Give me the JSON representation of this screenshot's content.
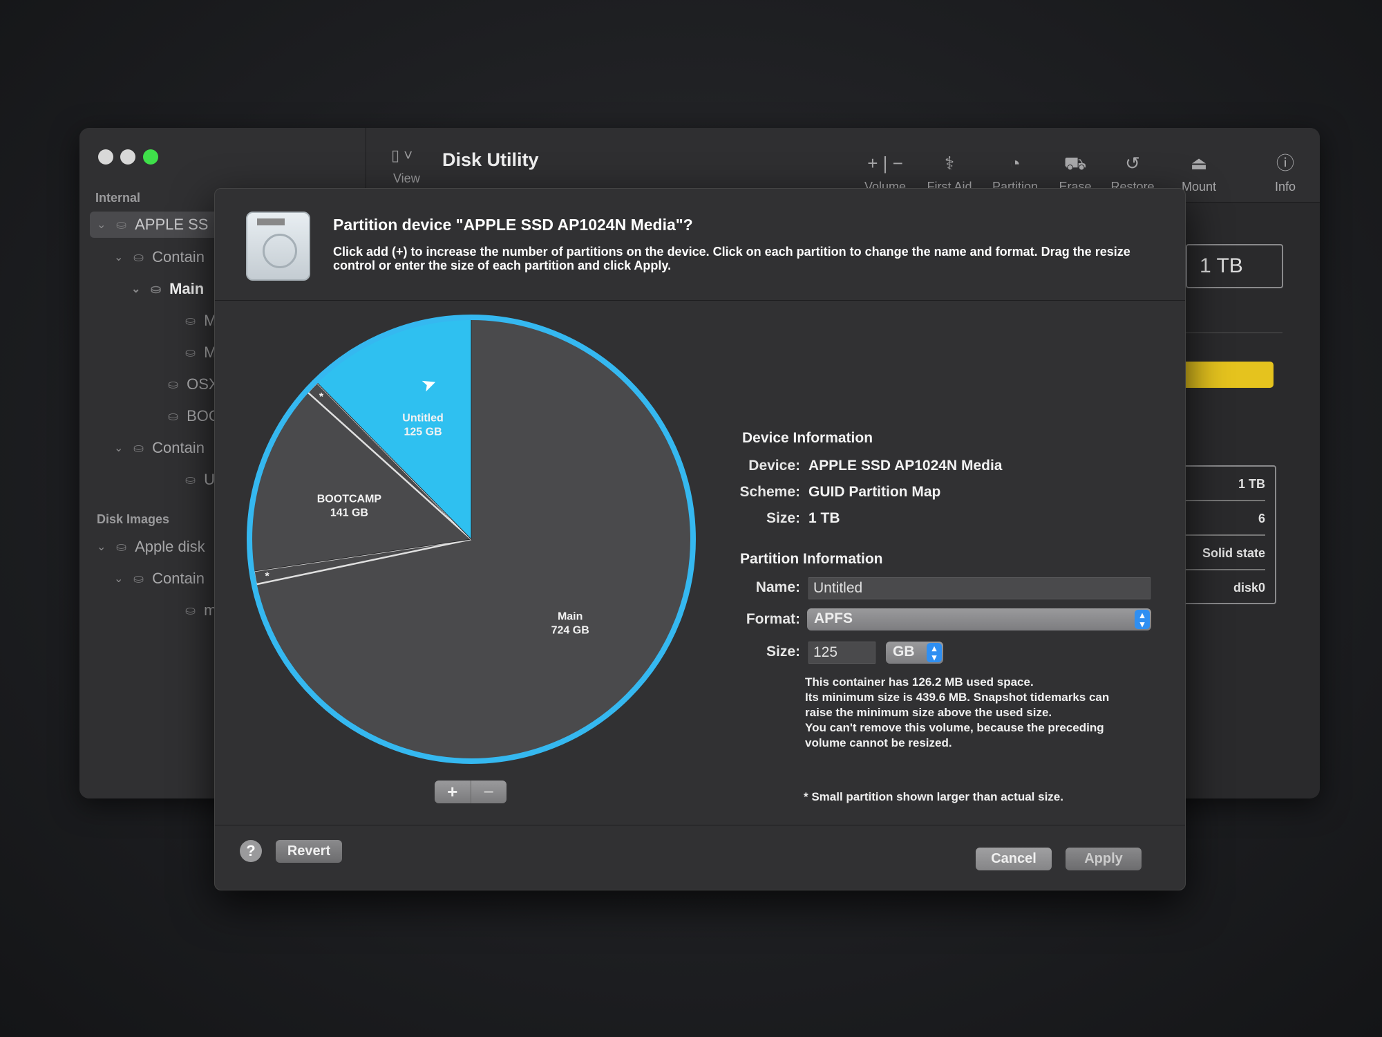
{
  "app": {
    "title": "Disk Utility",
    "view_label": "View"
  },
  "toolbar": [
    {
      "label": "Volume",
      "icon": "plus-minus-icon",
      "glyph": "+ | −"
    },
    {
      "label": "First Aid",
      "icon": "stethoscope-icon",
      "glyph": "⚕"
    },
    {
      "label": "Partition",
      "icon": "pie-icon",
      "glyph": "◔"
    },
    {
      "label": "Erase",
      "icon": "erase-disk-icon",
      "glyph": "⛟"
    },
    {
      "label": "Restore",
      "icon": "restore-icon",
      "glyph": "↺"
    },
    {
      "label": "Mount",
      "icon": "mount-icon",
      "glyph": "⏏"
    },
    {
      "label": "Info",
      "icon": "info-icon",
      "glyph": "ⓘ"
    }
  ],
  "sidebar": {
    "internal_header": "Internal",
    "disk_images_header": "Disk Images",
    "items": [
      {
        "label": "APPLE SS",
        "icon": "disk-icon",
        "chev": true
      },
      {
        "label": "Contain",
        "icon": "container-icon",
        "chev": true
      },
      {
        "label": "Main",
        "icon": "volume-group-icon",
        "chev": true
      },
      {
        "label": "Ma",
        "icon": "volume-icon",
        "chev": false
      },
      {
        "label": "Ma",
        "icon": "volume-icon",
        "chev": false
      },
      {
        "label": "OSXRES",
        "icon": "volume-icon",
        "chev": false
      },
      {
        "label": "BOOTC",
        "icon": "volume-icon",
        "chev": false
      },
      {
        "label": "Contain",
        "icon": "container-icon",
        "chev": true
      },
      {
        "label": "Untit",
        "icon": "volume-icon",
        "chev": false
      },
      {
        "label": "Apple disk",
        "icon": "disk-icon",
        "chev": true
      },
      {
        "label": "Contain",
        "icon": "container-icon",
        "chev": true
      },
      {
        "label": "macO",
        "icon": "volume-icon",
        "chev": false
      }
    ]
  },
  "right_panel": {
    "capacity": "1 TB",
    "table": [
      "1 TB",
      "6",
      "Solid state",
      "disk0"
    ],
    "bar_color": "#e5c31e"
  },
  "dialog": {
    "title": "Partition device \"APPLE SSD AP1024N Media\"?",
    "description": "Click add (+) to increase the number of partitions on the device. Click on each partition to change the name and format. Drag the resize control or enter the size of each partition and click Apply.",
    "device_info": {
      "header": "Device Information",
      "device_label": "Device:",
      "device": "APPLE SSD AP1024N Media",
      "scheme_label": "Scheme:",
      "scheme": "GUID Partition Map",
      "size_label": "Size:",
      "size": "1 TB"
    },
    "partition_info": {
      "header": "Partition Information",
      "name_label": "Name:",
      "name": "Untitled",
      "format_label": "Format:",
      "format": "APFS",
      "size_label": "Size:",
      "size": "125",
      "unit": "GB"
    },
    "notes": [
      "This container has 126.2 MB used space.",
      "Its minimum size is 439.6 MB. Snapshot tidemarks can",
      "raise the minimum size above the used size.",
      "You can't remove this volume, because the preceding",
      "volume cannot be resized."
    ],
    "footnote": "* Small partition shown larger than actual size.",
    "add_label": "+",
    "remove_label": "−",
    "help_label": "?",
    "revert_label": "Revert",
    "cancel_label": "Cancel",
    "apply_label": "Apply"
  },
  "chart_data": {
    "type": "pie",
    "unit": "GB",
    "selected": "Untitled",
    "slices": [
      {
        "name": "Main",
        "size": "724 GB",
        "value": 724,
        "color": "#4a4a4c"
      },
      {
        "name": "*",
        "size": "",
        "value": null,
        "small": true,
        "color": "#4a4a4c"
      },
      {
        "name": "BOOTCAMP",
        "size": "141 GB",
        "value": 141,
        "color": "#4a4a4c"
      },
      {
        "name": "*",
        "size": "",
        "value": null,
        "small": true,
        "color": "#4a4a4c"
      },
      {
        "name": "Untitled",
        "size": "125 GB",
        "value": 125,
        "color": "#2fc0f0"
      }
    ],
    "ring_color": "#35b8f0"
  }
}
